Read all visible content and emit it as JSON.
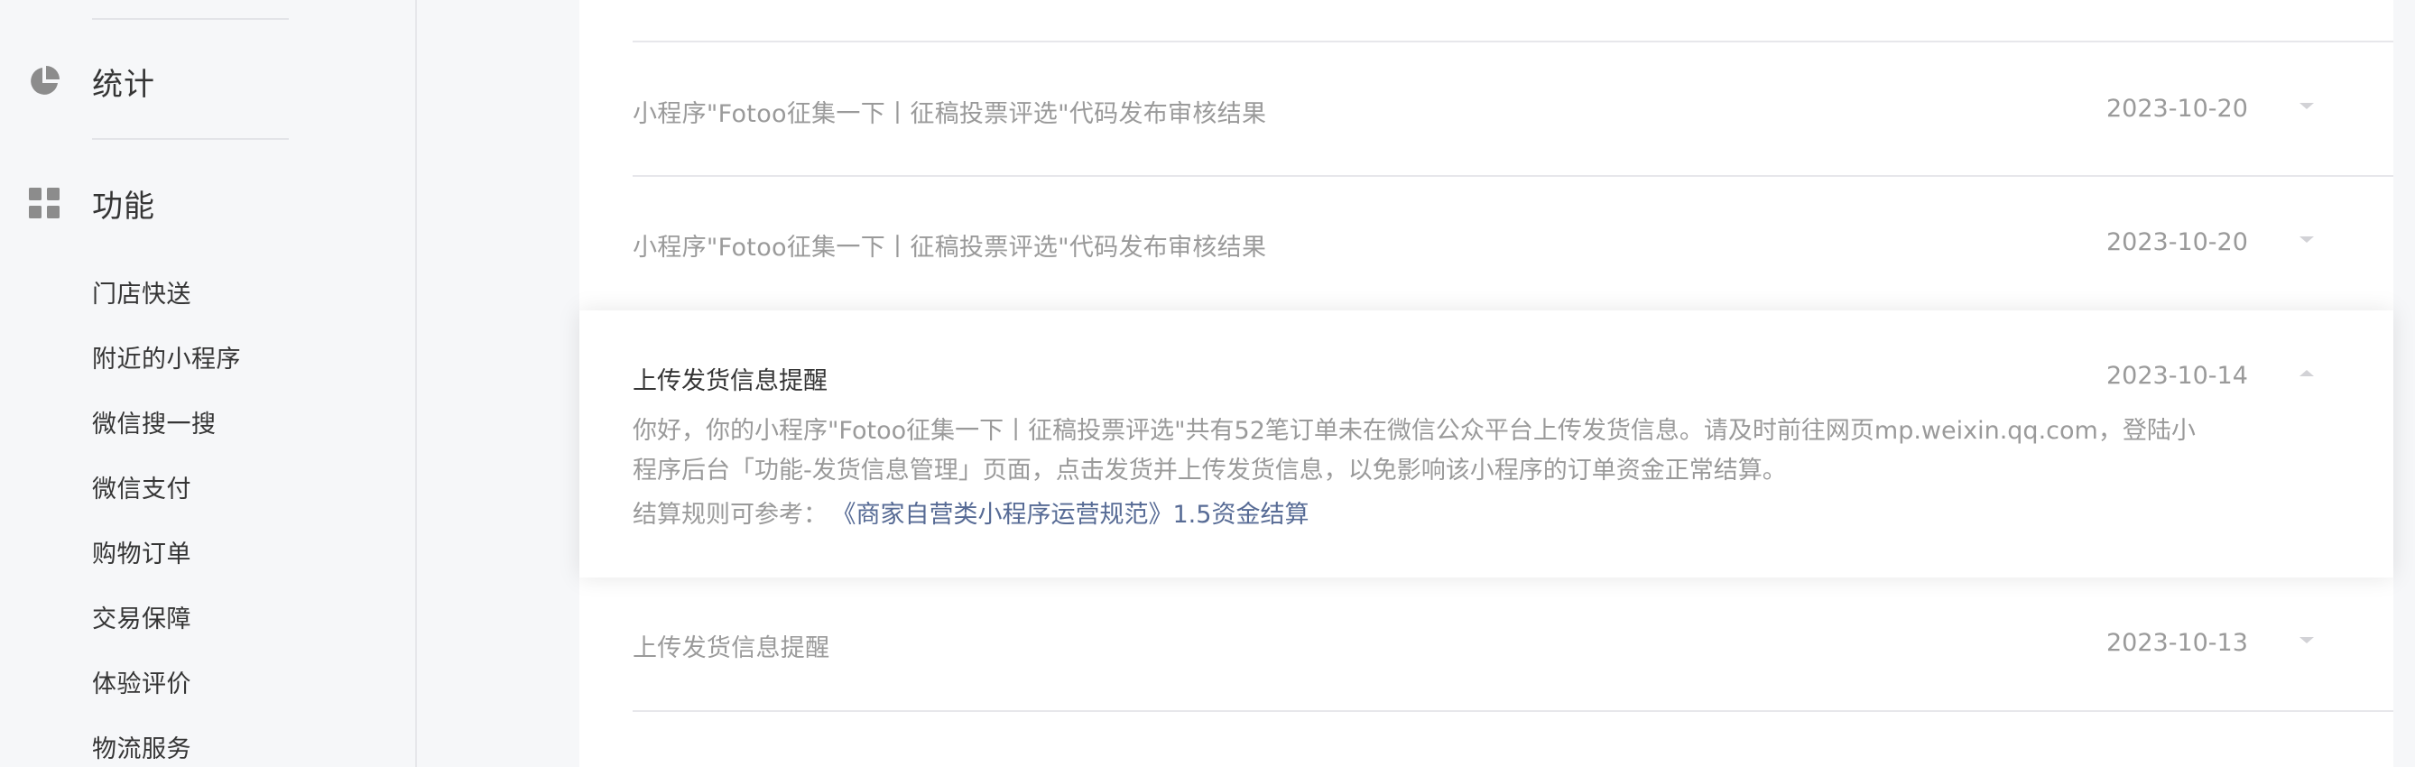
{
  "sidebar": {
    "sections": [
      {
        "icon": "pie-chart-icon",
        "label": "统计"
      },
      {
        "icon": "grid-icon",
        "label": "功能"
      }
    ],
    "items": [
      {
        "label": "门店快送"
      },
      {
        "label": "附近的小程序"
      },
      {
        "label": "微信搜一搜"
      },
      {
        "label": "微信支付"
      },
      {
        "label": "购物订单"
      },
      {
        "label": "交易保障"
      },
      {
        "label": "体验评价"
      },
      {
        "label": "物流服务"
      }
    ]
  },
  "messages": [
    {
      "title": "小程序\"Fotoo征集一下丨征稿投票评选\"代码发布审核结果",
      "date": "2023-10-20",
      "expanded": false
    },
    {
      "title": "小程序\"Fotoo征集一下丨征稿投票评选\"代码发布审核结果",
      "date": "2023-10-20",
      "expanded": false
    },
    {
      "title": "上传发货信息提醒",
      "date": "2023-10-14",
      "expanded": true,
      "body_line1": "你好，你的小程序\"Fotoo征集一下丨征稿投票评选\"共有52笔订单未在微信公众平台上传发货信息。请及时前往网页mp.weixin.qq.com，登陆小",
      "body_line2": "程序后台「功能-发货信息管理」页面，点击发货并上传发货信息，以免影响该小程序的订单资金正常结算。",
      "ref_label": "结算规则可参考：",
      "ref_link": "《商家自营类小程序运营规范》1.5资金结算"
    },
    {
      "title": "上传发货信息提醒",
      "date": "2023-10-13",
      "expanded": false
    }
  ],
  "colors": {
    "link": "#576b95",
    "muted_text": "#9a9a9a",
    "primary_text": "#353535",
    "divider": "#e7e7eb",
    "sidebar_bg": "#f6f7f9"
  }
}
